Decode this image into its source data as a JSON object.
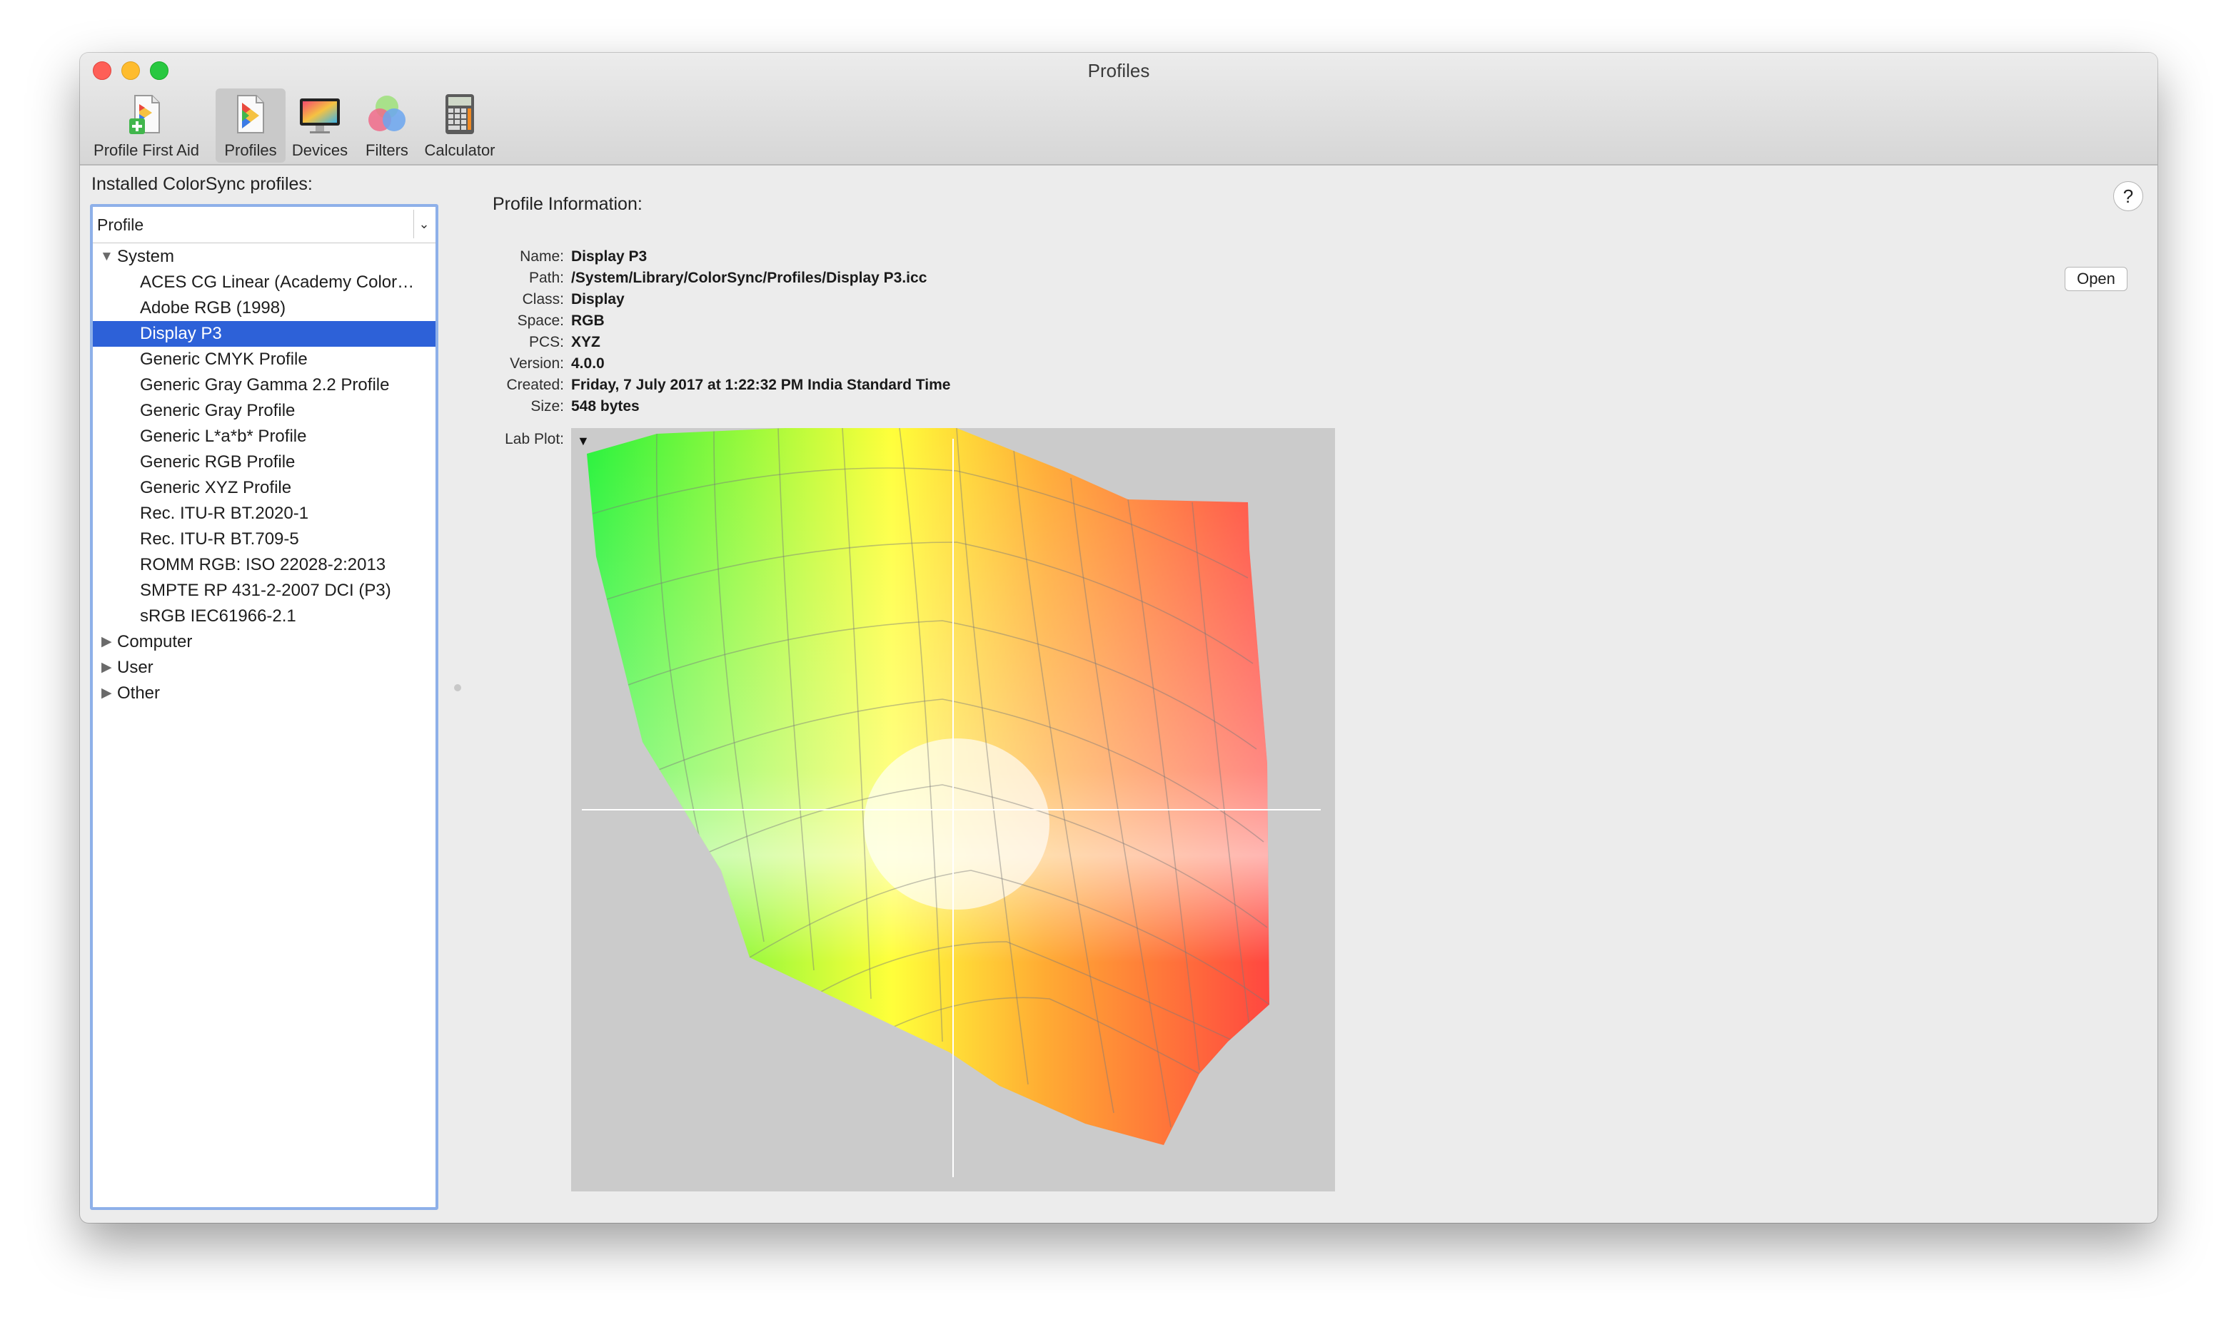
{
  "window": {
    "title": "Profiles"
  },
  "toolbar": {
    "items": [
      {
        "label": "Profile First Aid",
        "icon": "profile-first-aid-icon"
      },
      {
        "label": "Profiles",
        "icon": "profiles-icon"
      },
      {
        "label": "Devices",
        "icon": "display-icon"
      },
      {
        "label": "Filters",
        "icon": "color-circles-icon"
      },
      {
        "label": "Calculator",
        "icon": "calculator-icon"
      }
    ]
  },
  "sidebar": {
    "title": "Installed ColorSync profiles:",
    "header_label": "Profile",
    "groups": [
      {
        "label": "System",
        "expanded": true
      },
      {
        "label": "Computer",
        "expanded": false
      },
      {
        "label": "User",
        "expanded": false
      },
      {
        "label": "Other",
        "expanded": false
      }
    ],
    "system_items": [
      "ACES CG Linear (Academy Color…",
      "Adobe RGB (1998)",
      "Display P3",
      "Generic CMYK Profile",
      "Generic Gray Gamma 2.2 Profile",
      "Generic Gray Profile",
      "Generic L*a*b* Profile",
      "Generic RGB Profile",
      "Generic XYZ Profile",
      "Rec. ITU-R BT.2020-1",
      "Rec. ITU-R BT.709-5",
      "ROMM RGB: ISO 22028-2:2013",
      "SMPTE RP 431-2-2007 DCI (P3)",
      "sRGB IEC61966-2.1"
    ],
    "selected": "Display P3"
  },
  "info": {
    "title": "Profile Information:",
    "labels": {
      "name": "Name:",
      "path": "Path:",
      "class": "Class:",
      "space": "Space:",
      "pcs": "PCS:",
      "version": "Version:",
      "created": "Created:",
      "size": "Size:",
      "lab_plot": "Lab Plot:"
    },
    "values": {
      "name": "Display P3",
      "path": "/System/Library/ColorSync/Profiles/Display P3.icc",
      "class": "Display",
      "space": "RGB",
      "pcs": "XYZ",
      "version": "4.0.0",
      "created": "Friday, 7 July 2017 at 1:22:32 PM India Standard Time",
      "size": "548 bytes"
    },
    "open_label": "Open",
    "help_label": "?"
  },
  "colors": {
    "selection": "#2d61d8",
    "list_border": "#8eb0e9",
    "plot_bg": "#cbcbcb"
  }
}
